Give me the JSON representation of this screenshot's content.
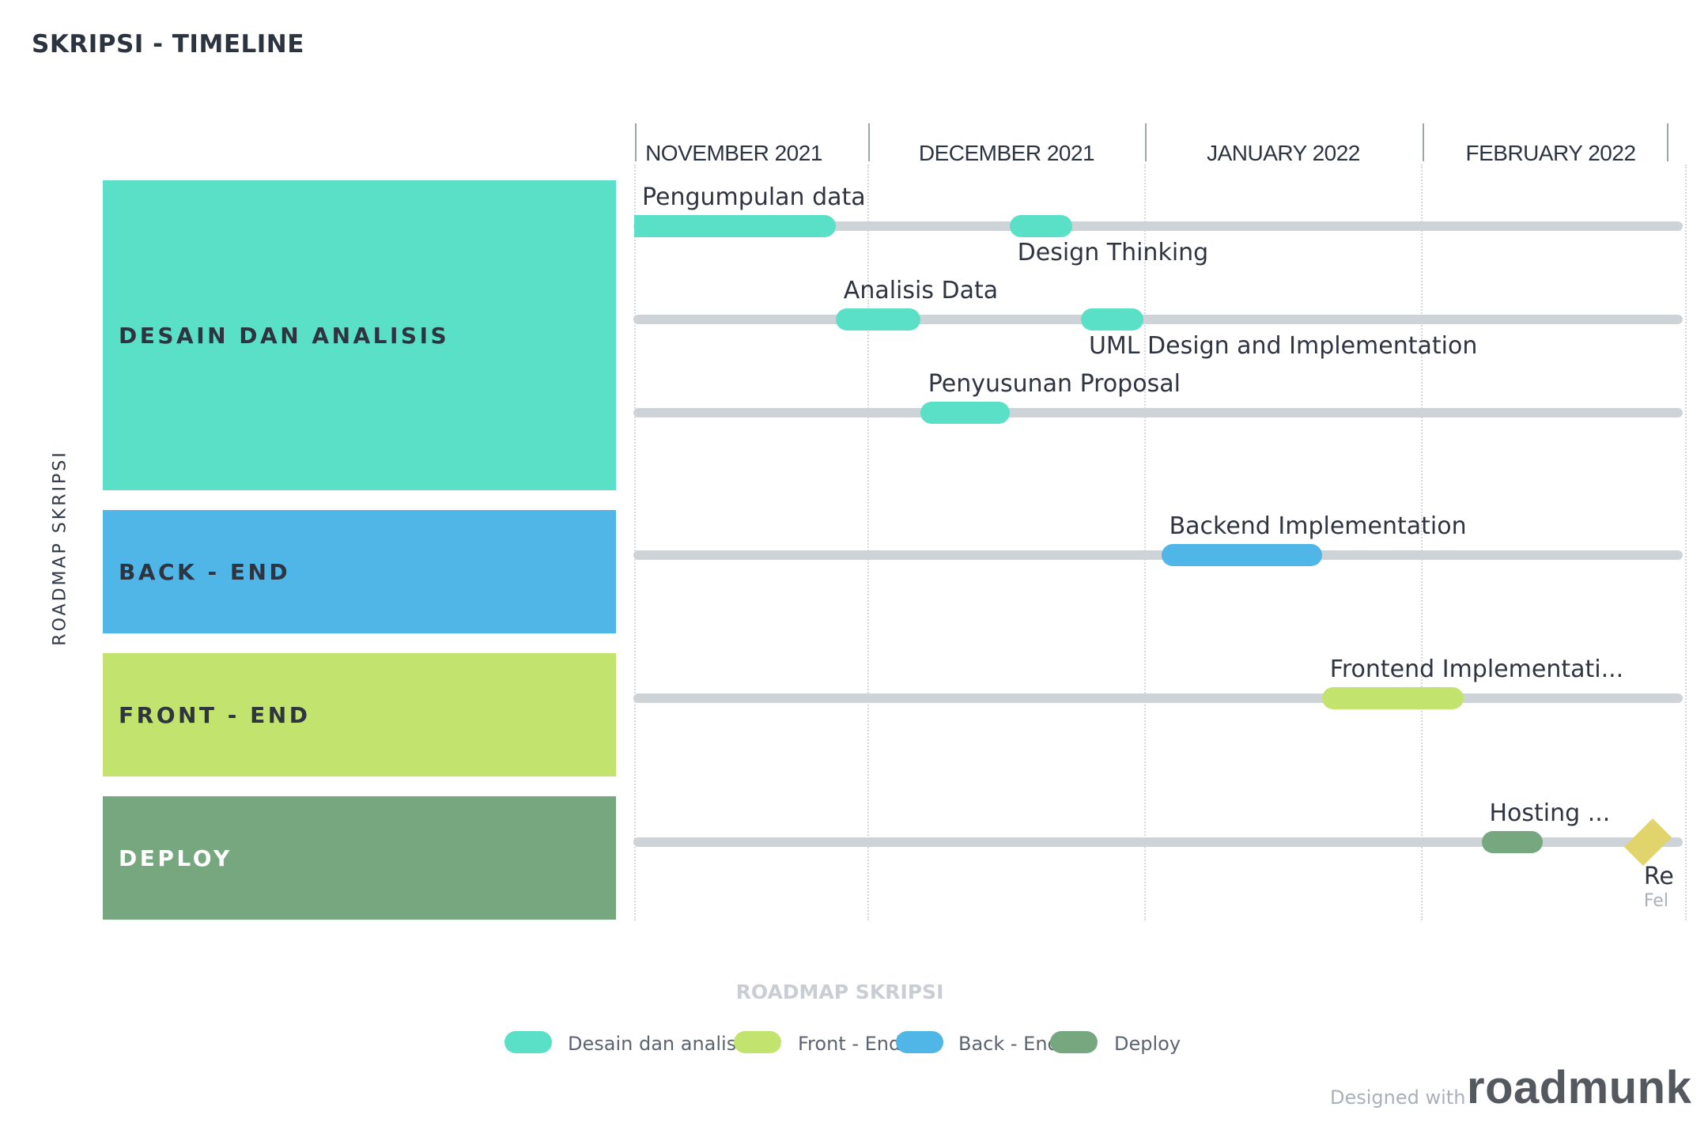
{
  "page": {
    "title": "SKRIPSI - TIMELINE"
  },
  "chart_data": {
    "type": "timeline",
    "title": "SKRIPSI - TIMELINE",
    "y_axis_label": "ROADMAP SKRIPSI",
    "footer_label": "ROADMAP SKRIPSI",
    "time_range": [
      "2021-11-01",
      "2022-02-28"
    ],
    "months": [
      "NOVEMBER 2021",
      "DECEMBER 2021",
      "JANUARY 2022",
      "FEBRUARY 2022"
    ],
    "lanes": [
      {
        "name": "DESAIN DAN ANALISIS",
        "color": "#5ae0c6",
        "text_color": "#2e3440"
      },
      {
        "name": "BACK - END",
        "color": "#50b6e8",
        "text_color": "#2e3440"
      },
      {
        "name": "FRONT - END",
        "color": "#c2e46e",
        "text_color": "#2e3440"
      },
      {
        "name": "DEPLOY",
        "color": "#76a77e",
        "text_color": "#ffffff"
      }
    ],
    "items": [
      {
        "label": "Pengumpulan data",
        "lane": 0,
        "row": 0,
        "start": "2021-11-01",
        "end": "2021-11-27",
        "label_position": "above"
      },
      {
        "label": "Design Thinking",
        "lane": 0,
        "row": 0,
        "start": "2021-12-17",
        "end": "2021-12-24",
        "label_position": "below"
      },
      {
        "label": "Analisis Data",
        "lane": 0,
        "row": 1,
        "start": "2021-11-27",
        "end": "2021-12-07",
        "label_position": "above"
      },
      {
        "label": "UML Design and Implementation",
        "lane": 0,
        "row": 1,
        "start": "2021-12-25",
        "end": "2022-01-01",
        "label_position": "below"
      },
      {
        "label": "Penyusunan Proposal",
        "lane": 0,
        "row": 2,
        "start": "2021-12-07",
        "end": "2021-12-17",
        "label_position": "above"
      },
      {
        "label": "Backend Implementation",
        "lane": 1,
        "row": 0,
        "start": "2022-01-03",
        "end": "2022-01-21",
        "label_position": "above"
      },
      {
        "label": "Frontend Implementati...",
        "lane": 2,
        "row": 0,
        "start": "2022-01-21",
        "end": "2022-02-06",
        "label_position": "above"
      },
      {
        "label": "Hosting ...",
        "lane": 3,
        "row": 0,
        "start": "2022-02-08",
        "end": "2022-02-15",
        "label_position": "above"
      }
    ],
    "milestones": [
      {
        "label": "Re",
        "date_label": "Fel",
        "lane": 3,
        "date": "2022-02-27"
      }
    ],
    "legend": [
      {
        "label": "Desain dan analisis",
        "color": "#5ae0c6"
      },
      {
        "label": "Front - End",
        "color": "#c2e46e"
      },
      {
        "label": "Back - End",
        "color": "#50b6e8"
      },
      {
        "label": "Deploy",
        "color": "#76a77e"
      }
    ],
    "grid": true
  },
  "credit": {
    "text": "Designed with",
    "brand": "roadmunk"
  }
}
